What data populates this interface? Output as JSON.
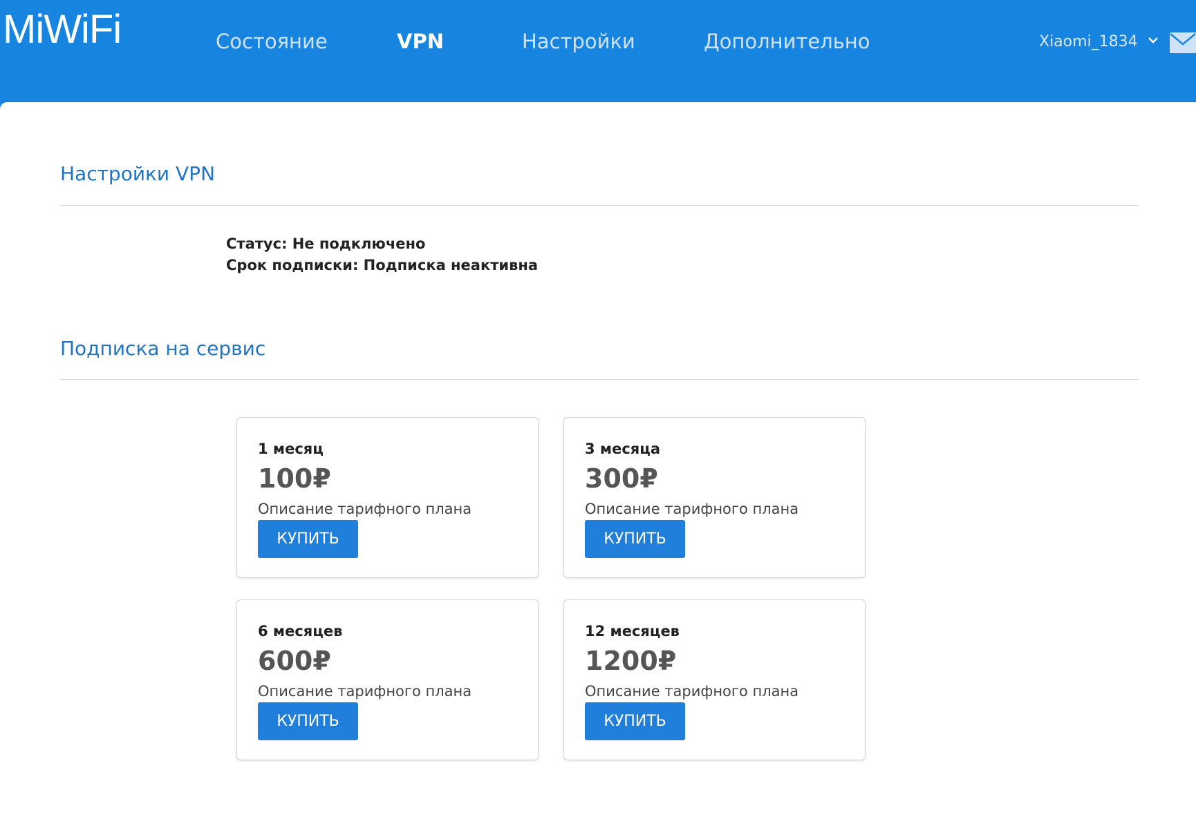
{
  "header": {
    "logo": "MiWiFi",
    "nav": [
      {
        "label": "Состояние",
        "active": false
      },
      {
        "label": "VPN",
        "active": true
      },
      {
        "label": "Настройки",
        "active": false
      },
      {
        "label": "Дополнительно",
        "active": false
      }
    ],
    "user": "Xiaomi_1834",
    "icons": {
      "user_menu": "chevron-down-icon",
      "messages": "mail-icon"
    }
  },
  "vpn_settings": {
    "title": "Настройки VPN",
    "status": "Статус: Не подключено",
    "subscription": "Срок подписки: Подписка неактивна"
  },
  "subscription": {
    "title": "Подписка на сервис",
    "plans": [
      {
        "period": "1 месяц",
        "price": "100₽",
        "description": "Описание тарифного плана",
        "button": "КУПИТЬ"
      },
      {
        "period": "3 месяца",
        "price": "300₽",
        "description": "Описание тарифного плана",
        "button": "КУПИТЬ"
      },
      {
        "period": "6 месяцев",
        "price": "600₽",
        "description": "Описание тарифного плана",
        "button": "КУПИТЬ"
      },
      {
        "period": "12 месяцев",
        "price": "1200₽",
        "description": "Описание тарифного плана",
        "button": "КУПИТЬ"
      }
    ]
  },
  "colors": {
    "header": "#1784e0",
    "accent": "#1f7fdb",
    "section_title": "#1f74c6"
  }
}
